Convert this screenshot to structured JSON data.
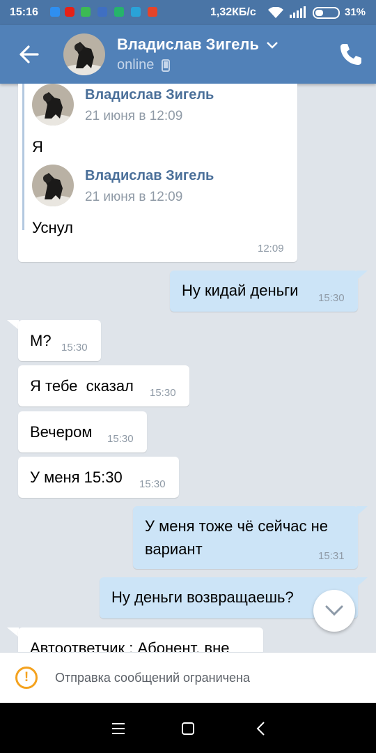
{
  "status_bar": {
    "time": "15:16",
    "speed": "1,32КБ/с",
    "battery": "31%"
  },
  "header": {
    "name": "Владислав Зигель",
    "status": "online"
  },
  "forwarded": {
    "items": [
      {
        "name": "Владислав Зигель",
        "date": "21 июня в 12:09",
        "text": "Я"
      },
      {
        "name": "Владислав Зигель",
        "date": "21 июня в 12:09",
        "text": "Уснул"
      }
    ],
    "time": "12:09"
  },
  "messages": [
    {
      "text": "Ну кидай деньги",
      "time": "15:30"
    },
    {
      "text": "М?",
      "time": "15:30"
    },
    {
      "text": "Я тебе  сказал",
      "time": "15:30"
    },
    {
      "text": "Вечером",
      "time": "15:30"
    },
    {
      "text": "У меня 15:30",
      "time": "15:30"
    },
    {
      "text_line1": "У меня тоже чё сейчас не",
      "text_line2": "вариант",
      "time": "15:31"
    },
    {
      "text": "Ну деньги возвращаешь?"
    },
    {
      "text": "Автоответчик : Абонент, вне"
    }
  ],
  "restriction": {
    "text": "Отправка сообщений ограничена"
  },
  "colors": {
    "header": "#5181b8",
    "outgoing": "#cce4f7",
    "incoming": "#ffffff",
    "warning": "#f4a21e"
  }
}
